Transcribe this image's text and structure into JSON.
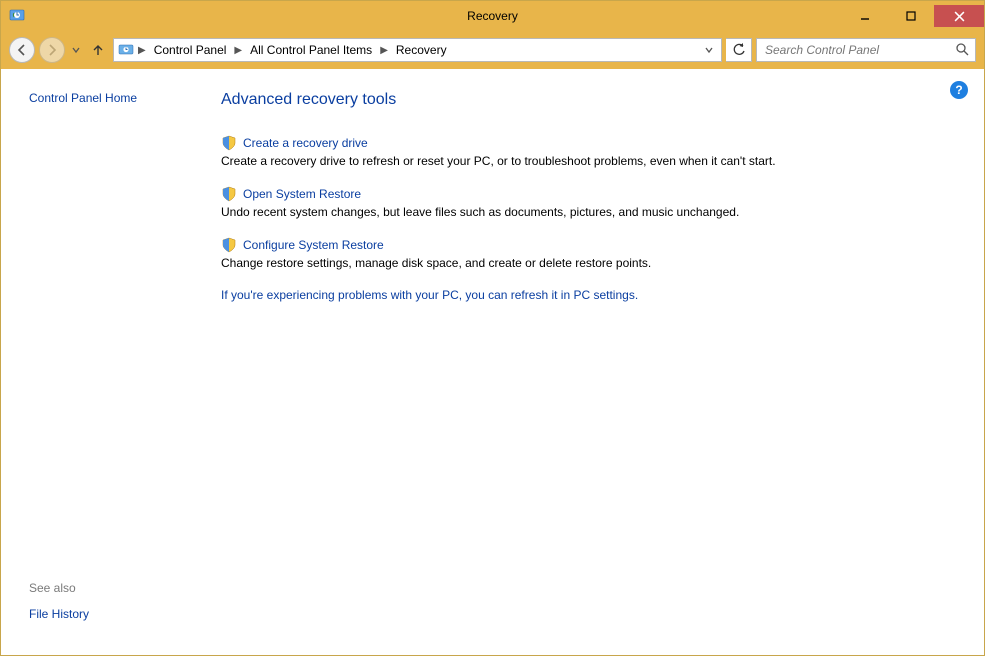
{
  "window": {
    "title": "Recovery"
  },
  "breadcrumb": {
    "items": [
      "Control Panel",
      "All Control Panel Items",
      "Recovery"
    ]
  },
  "search": {
    "placeholder": "Search Control Panel"
  },
  "sidebar": {
    "home_link": "Control Panel Home",
    "see_also_label": "See also",
    "see_also_links": [
      "File History"
    ]
  },
  "main": {
    "heading": "Advanced recovery tools",
    "tools": [
      {
        "link": "Create a recovery drive",
        "desc": "Create a recovery drive to refresh or reset your PC, or to troubleshoot problems, even when it can't start."
      },
      {
        "link": "Open System Restore",
        "desc": "Undo recent system changes, but leave files such as documents, pictures, and music unchanged."
      },
      {
        "link": "Configure System Restore",
        "desc": "Change restore settings, manage disk space, and create or delete restore points."
      }
    ],
    "footer_link": "If you're experiencing problems with your PC, you can refresh it in PC settings."
  }
}
